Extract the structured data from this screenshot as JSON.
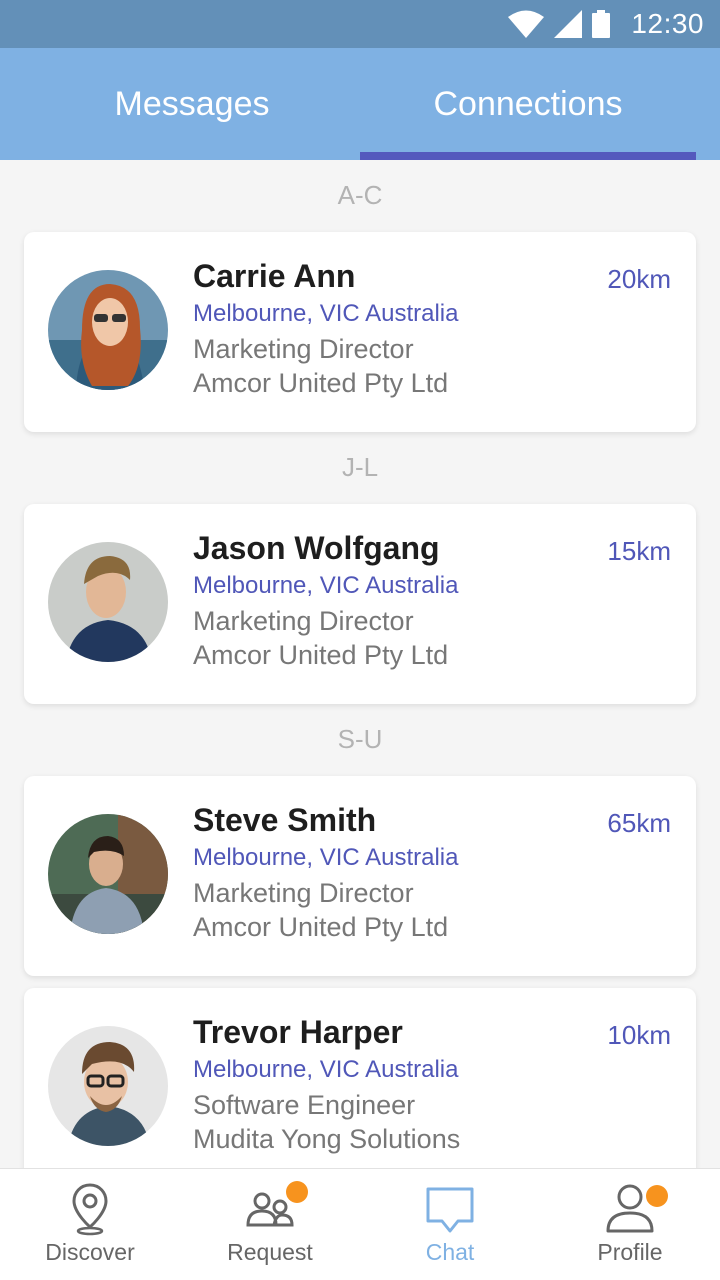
{
  "status_bar": {
    "time": "12:30"
  },
  "tabs": [
    {
      "label": "Messages",
      "active": false
    },
    {
      "label": "Connections",
      "active": true
    }
  ],
  "colors": {
    "accent": "#5057b8",
    "header": "#7fb1e3",
    "status_bar": "#6390b8",
    "badge": "#f7931e"
  },
  "sections": [
    {
      "header": "A-C"
    },
    {
      "header": "J-L"
    },
    {
      "header": "S-U"
    }
  ],
  "contacts": [
    {
      "name": "Carrie Ann",
      "location": "Melbourne, VIC Australia",
      "role": "Marketing Director",
      "company": "Amcor United Pty Ltd",
      "distance": "20km"
    },
    {
      "name": "Jason Wolfgang",
      "location": "Melbourne, VIC Australia",
      "role": "Marketing Director",
      "company": "Amcor United Pty Ltd",
      "distance": "15km"
    },
    {
      "name": "Steve Smith",
      "location": "Melbourne, VIC Australia",
      "role": "Marketing Director",
      "company": "Amcor United Pty Ltd",
      "distance": "65km"
    },
    {
      "name": "Trevor Harper",
      "location": "Melbourne, VIC Australia",
      "role": "Software Engineer",
      "company": "Mudita Yong Solutions",
      "distance": "10km"
    }
  ],
  "bottom_nav": [
    {
      "label": "Discover",
      "icon": "location-pin-icon",
      "active": false,
      "badge": false
    },
    {
      "label": "Request",
      "icon": "people-icon",
      "active": false,
      "badge": true
    },
    {
      "label": "Chat",
      "icon": "chat-bubble-icon",
      "active": true,
      "badge": false
    },
    {
      "label": "Profile",
      "icon": "person-icon",
      "active": false,
      "badge": true
    }
  ]
}
